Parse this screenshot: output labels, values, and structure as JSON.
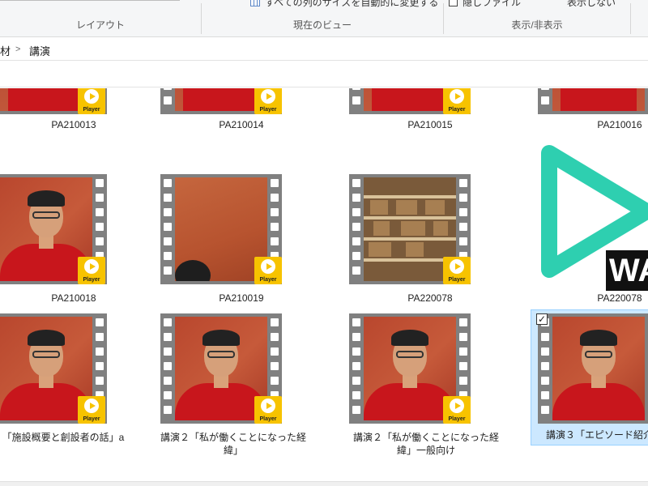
{
  "ribbon": {
    "groups": [
      {
        "label": "レイアウト"
      },
      {
        "label": "現在のビュー"
      },
      {
        "label": "表示/非表示"
      }
    ],
    "commands": {
      "autosize_columns": "すべての列のサイズを自動的に変更する",
      "hidden_files": "隠しファイル",
      "hide_selected": "表示しない"
    }
  },
  "breadcrumb": {
    "parent": "材",
    "current": "講演"
  },
  "badge_text": "Player",
  "big_logo_text": "WA",
  "colors": {
    "badge": "#f7c300",
    "logo": "#2ecfb0",
    "selection": "#cce8ff"
  },
  "tiles_row1": [
    {
      "name": "PA210013"
    },
    {
      "name": "PA210014"
    },
    {
      "name": "PA210015"
    },
    {
      "name": "PA210016"
    }
  ],
  "tiles_row2": [
    {
      "name": "PA210018"
    },
    {
      "name": "PA210019"
    },
    {
      "name": "PA220078"
    },
    {
      "name": "PA220078"
    }
  ],
  "tiles_row3": [
    {
      "name": "「施設概要と創設者の話」a"
    },
    {
      "name": "講演２「私が働くことになった経緯」"
    },
    {
      "name": "講演２「私が働くことになった経緯」一般向け"
    },
    {
      "name": "講演３「エピソード紹介"
    }
  ]
}
